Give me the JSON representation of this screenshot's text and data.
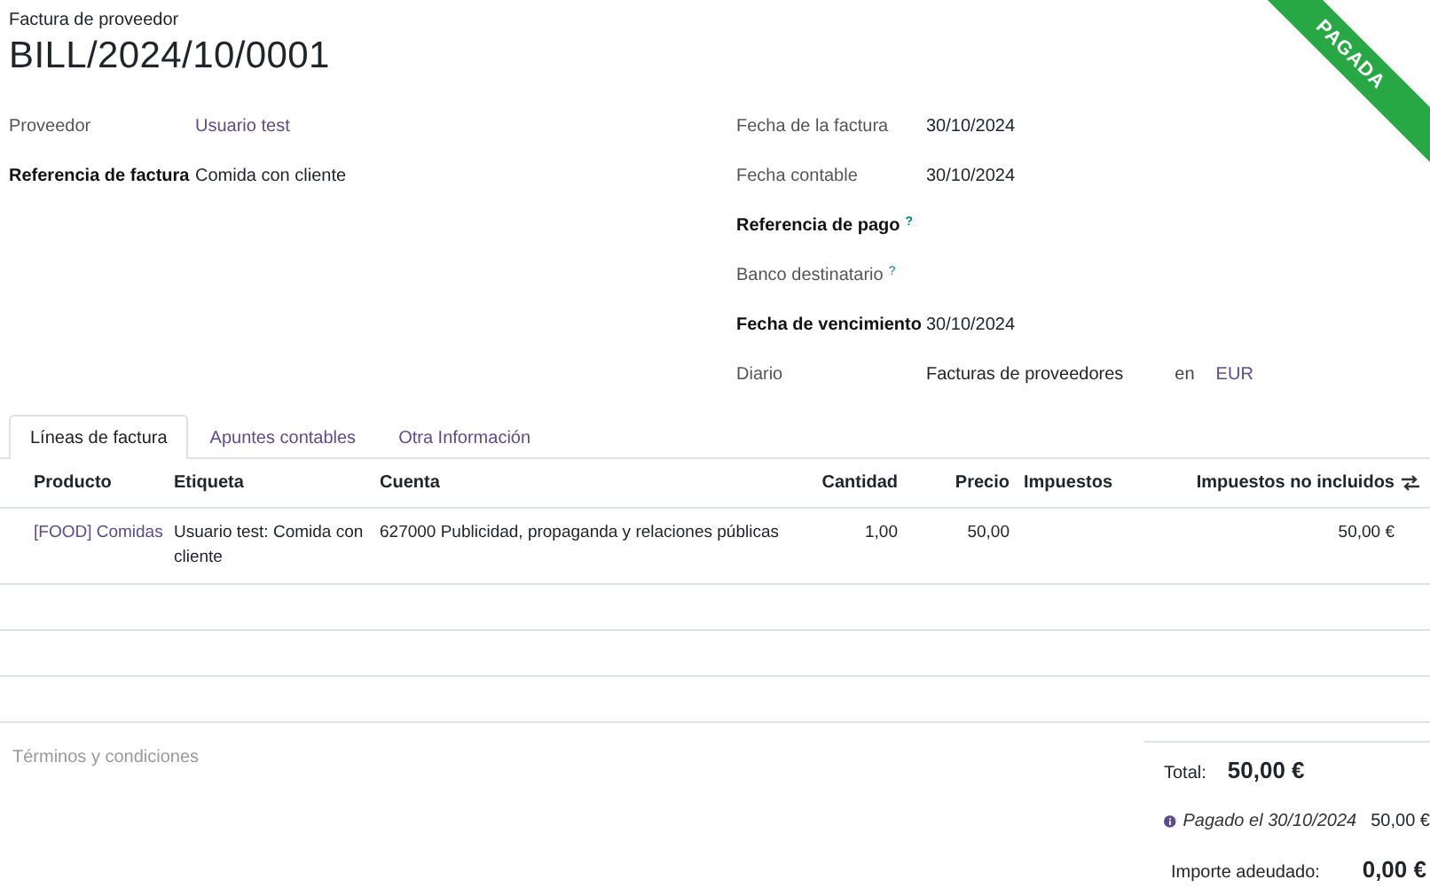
{
  "header": {
    "subtitle": "Factura de proveedor",
    "title": "BILL/2024/10/0001",
    "ribbon": "PAGADA"
  },
  "left_fields": [
    {
      "label": "Proveedor",
      "bold": false,
      "help": false,
      "value": "Usuario test",
      "link": true
    },
    {
      "label": "Referencia de factura",
      "bold": true,
      "help": false,
      "value": "Comida con cliente",
      "link": false
    }
  ],
  "right_fields": [
    {
      "label": "Fecha de la factura",
      "bold": false,
      "help": false,
      "value": "30/10/2024",
      "link": false
    },
    {
      "label": "Fecha contable",
      "bold": false,
      "help": false,
      "value": "30/10/2024",
      "link": false
    },
    {
      "label": "Referencia de pago",
      "bold": true,
      "help": true,
      "help_mark": "?"
    },
    {
      "label": "Banco destinatario",
      "bold": false,
      "help": true,
      "help_mark": "?"
    },
    {
      "label": "Fecha de vencimiento",
      "bold": true,
      "help": false,
      "value": "30/10/2024",
      "link": false
    },
    {
      "label": "Diario",
      "bold": false,
      "help": false,
      "value": "Facturas de proveedores",
      "link": false,
      "joiner": "en",
      "currency": "EUR"
    }
  ],
  "tabs": [
    {
      "label": "Líneas de factura",
      "selected": true
    },
    {
      "label": "Apuntes contables",
      "selected": false
    },
    {
      "label": "Otra Información",
      "selected": false
    }
  ],
  "table": {
    "columns": [
      {
        "label": "Producto",
        "kind": "text"
      },
      {
        "label": "Etiqueta",
        "kind": "text"
      },
      {
        "label": "Cuenta",
        "kind": "text"
      },
      {
        "label": "Cantidad",
        "kind": "number"
      },
      {
        "label": "Precio",
        "kind": "number"
      },
      {
        "label": "Impuestos",
        "kind": "text"
      },
      {
        "label": "Impuestos no incluidos",
        "kind": "number"
      }
    ],
    "rows": [
      {
        "cells": [
          "[FOOD] Comidas",
          "Usuario test: Comida con cliente",
          "627000 Publicidad, propaganda y relaciones públicas",
          "1,00",
          "50,00",
          "",
          "50,00 €"
        ]
      }
    ]
  },
  "terms": {
    "placeholder": "Términos y condiciones"
  },
  "totals": {
    "total_label": "Total:",
    "total_value": "50,00 €",
    "payments": [
      {
        "text": "Pagado el 30/10/2024",
        "amount": "50,00 €"
      }
    ],
    "due_label": "Importe adeudado:",
    "due_value": "0,00 €"
  }
}
